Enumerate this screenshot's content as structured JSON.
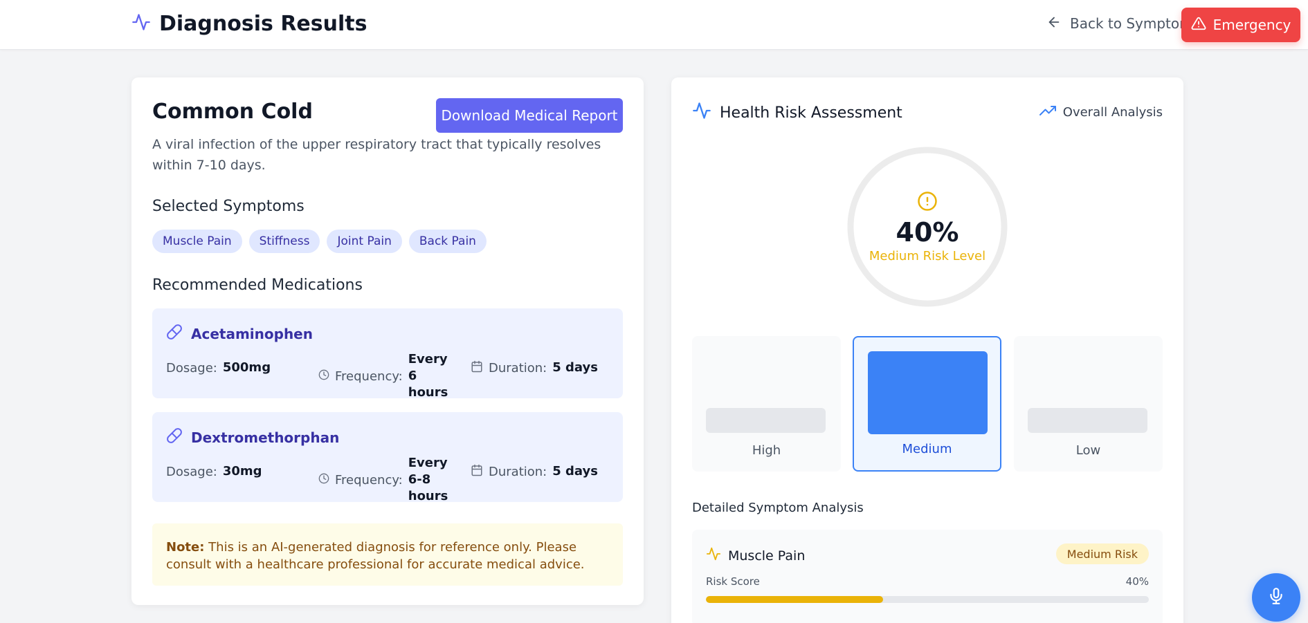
{
  "header": {
    "title": "Diagnosis Results",
    "back_label": "Back to Symptoms",
    "emergency_label": "Emergency"
  },
  "diagnosis": {
    "name": "Common Cold",
    "description": "A viral infection of the upper respiratory tract that typically resolves within 7-10 days.",
    "download_label": "Download Medical Report"
  },
  "symptoms": {
    "heading": "Selected Symptoms",
    "items": [
      "Muscle Pain",
      "Stiffness",
      "Joint Pain",
      "Back Pain"
    ]
  },
  "medications": {
    "heading": "Recommended Medications",
    "dosage_label": "Dosage:",
    "frequency_label": "Frequency:",
    "duration_label": "Duration:",
    "items": [
      {
        "name": "Acetaminophen",
        "dosage": "500mg",
        "frequency": "Every 6 hours",
        "duration": "5 days"
      },
      {
        "name": "Dextromethorphan",
        "dosage": "30mg",
        "frequency": "Every 6-8 hours",
        "duration": "5 days"
      }
    ]
  },
  "note": {
    "label": "Note:",
    "text": " This is an AI-generated diagnosis for reference only. Please consult with a healthcare professional for accurate medical advice."
  },
  "risk": {
    "title": "Health Risk Assessment",
    "overall_label": "Overall Analysis",
    "percent": "40%",
    "percent_value": 40,
    "level_text": "Medium Risk Level",
    "levels": [
      {
        "label": "High",
        "active": false
      },
      {
        "label": "Medium",
        "active": true
      },
      {
        "label": "Low",
        "active": false
      }
    ],
    "colors": {
      "accent": "#3b82f6",
      "medium": "#eab308"
    }
  },
  "symptom_analysis": {
    "title": "Detailed Symptom Analysis",
    "items": [
      {
        "name": "Muscle Pain",
        "badge": "Medium Risk",
        "score_label": "Risk Score",
        "score": "40%",
        "score_value": 40
      }
    ]
  },
  "icons": {
    "header": "activity-icon",
    "back": "arrow-left-icon",
    "emergency": "alert-triangle-icon",
    "medication": "pill-icon",
    "frequency": "clock-icon",
    "duration": "calendar-icon",
    "overall": "trending-up-icon",
    "risk_center": "alert-circle-icon",
    "mic": "mic-icon"
  }
}
